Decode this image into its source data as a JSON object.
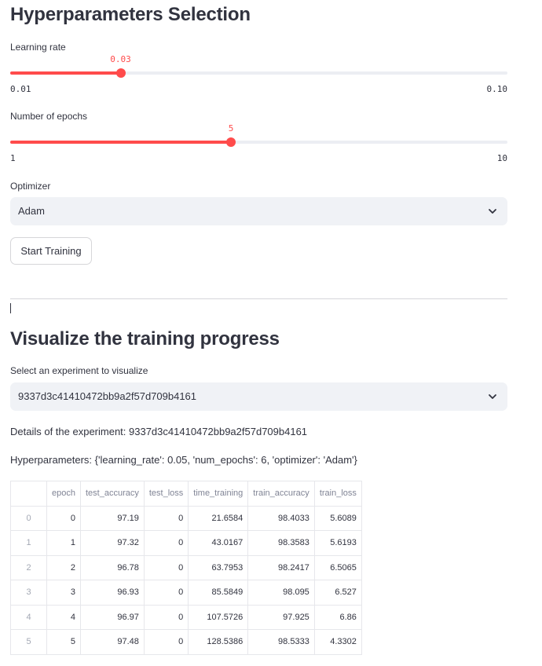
{
  "hyperparams": {
    "title": "Hyperparameters Selection",
    "learning_rate": {
      "label": "Learning rate",
      "value": "0.03",
      "min": "0.01",
      "max": "0.10",
      "fraction": 0.222
    },
    "epochs": {
      "label": "Number of epochs",
      "value": "5",
      "min": "1",
      "max": "10",
      "fraction": 0.444
    },
    "optimizer": {
      "label": "Optimizer",
      "selected": "Adam"
    },
    "start_button": "Start Training"
  },
  "visualize": {
    "title": "Visualize the training progress",
    "select_label": "Select an experiment to visualize",
    "selected_experiment": "9337d3c41410472bb9a2f57d709b4161",
    "details": "Details of the experiment: 9337d3c41410472bb9a2f57d709b4161",
    "hyperparameters": "Hyperparameters: {'learning_rate': 0.05, 'num_epochs': 6, 'optimizer': 'Adam'}"
  },
  "table": {
    "columns": [
      "",
      "epoch",
      "test_accuracy",
      "test_loss",
      "time_training",
      "train_accuracy",
      "train_loss"
    ],
    "rows": [
      [
        "0",
        "0",
        "97.19",
        "0",
        "21.6584",
        "98.4033",
        "5.6089"
      ],
      [
        "1",
        "1",
        "97.32",
        "0",
        "43.0167",
        "98.3583",
        "5.6193"
      ],
      [
        "2",
        "2",
        "96.78",
        "0",
        "63.7953",
        "98.2417",
        "6.5065"
      ],
      [
        "3",
        "3",
        "96.93",
        "0",
        "85.5849",
        "98.095",
        "6.527"
      ],
      [
        "4",
        "4",
        "96.97",
        "0",
        "107.5726",
        "97.925",
        "6.86"
      ],
      [
        "5",
        "5",
        "97.48",
        "0",
        "128.5386",
        "98.5333",
        "4.3302"
      ]
    ]
  },
  "colors": {
    "accent": "#ff4b4b",
    "track": "#eceef3",
    "select_bg": "#f0f2f6",
    "text": "#31333f"
  },
  "icons": {
    "select_chevron": "chevron-down-icon"
  }
}
